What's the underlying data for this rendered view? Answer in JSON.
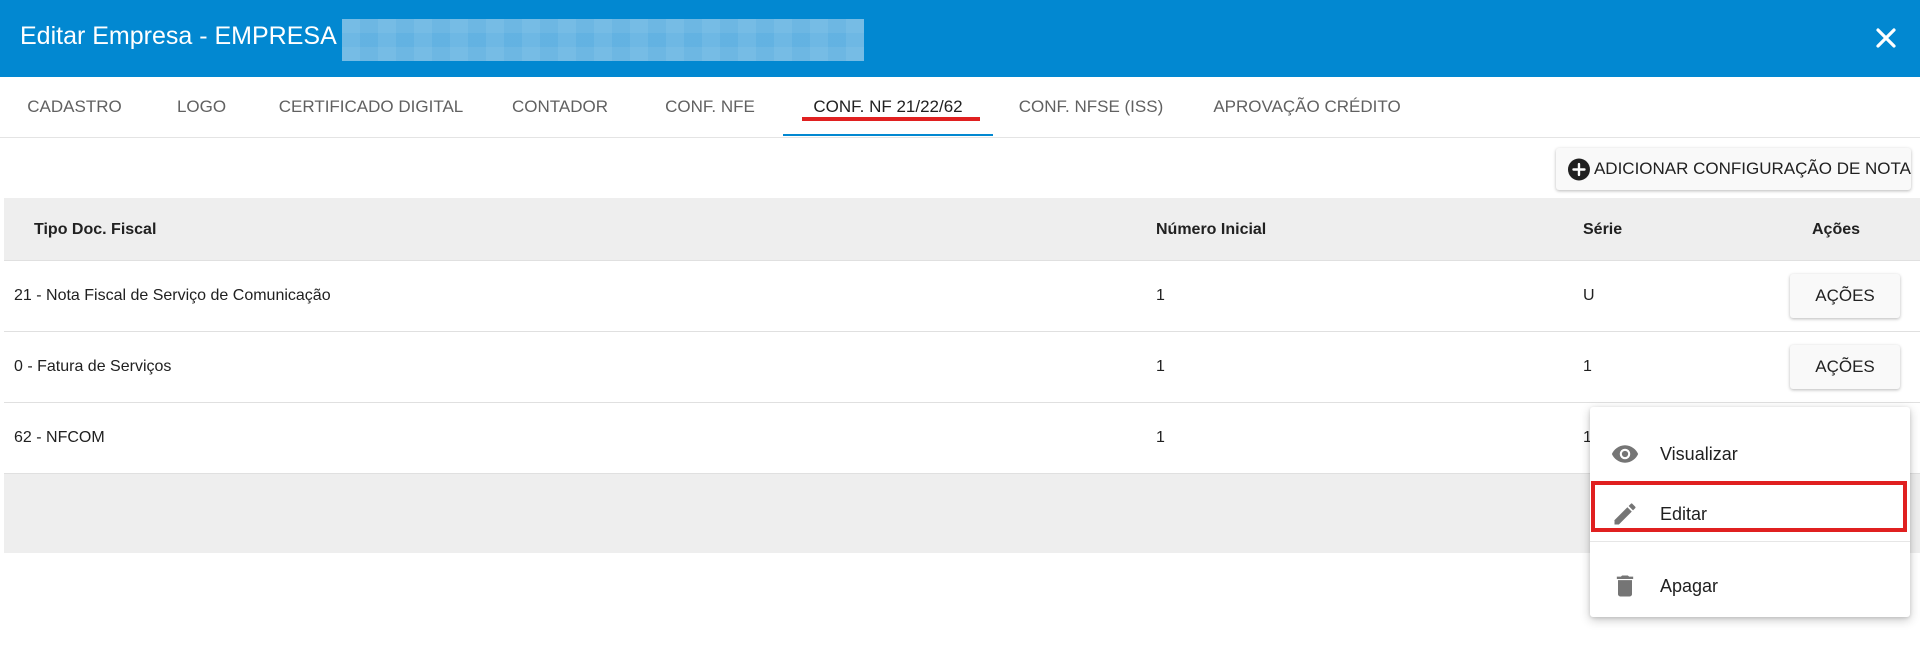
{
  "dialog": {
    "title": "Editar Empresa - EMPRESA -",
    "close_icon": "close-icon"
  },
  "tabs": [
    {
      "label": "Cadastro"
    },
    {
      "label": "Logo"
    },
    {
      "label": "Certificado Digital"
    },
    {
      "label": "Contador"
    },
    {
      "label": "Conf. NFe"
    },
    {
      "label": "Conf. NF 21/22/62",
      "active": true
    },
    {
      "label": "Conf. NFSe (ISS)"
    },
    {
      "label": "Aprovação Crédito"
    }
  ],
  "toolbar": {
    "add_label": "Adicionar Configuração de Nota",
    "add_icon": "add-circle-icon"
  },
  "table": {
    "headers": {
      "tipo": "Tipo Doc. Fiscal",
      "numero": "Número Inicial",
      "serie": "Série",
      "acoes": "Ações"
    },
    "rows": [
      {
        "tipo": "21 - Nota Fiscal de Serviço de Comunicação",
        "numero": "1",
        "serie": "U",
        "acoes_label": "Ações"
      },
      {
        "tipo": "0 - Fatura de Serviços",
        "numero": "1",
        "serie": "1",
        "acoes_label": "Ações"
      },
      {
        "tipo": "62 - NFCOM",
        "numero": "1",
        "serie": "1"
      }
    ]
  },
  "actions_menu": {
    "items": [
      {
        "label": "Visualizar",
        "icon": "eye-icon"
      },
      {
        "label": "Editar",
        "icon": "pencil-icon"
      },
      {
        "label": "Apagar",
        "icon": "trash-icon"
      }
    ]
  },
  "colors": {
    "primary": "#0288d1",
    "annotation_red": "#e02020",
    "header_bg": "#eeeeee"
  }
}
